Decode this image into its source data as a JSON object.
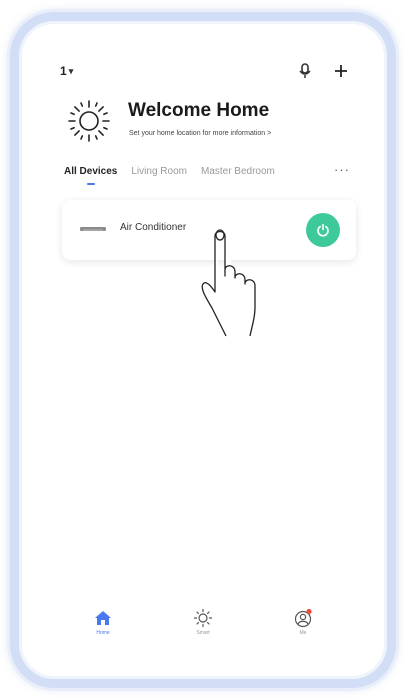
{
  "topbar": {
    "home_label": "1",
    "home_chevron": "chevron-down-icon",
    "icons": [
      "microphone-icon",
      "plus-icon"
    ]
  },
  "welcome": {
    "title": "Welcome Home",
    "subtitle": "Set your home location for more information >",
    "icon": "sun-icon"
  },
  "tabs": [
    {
      "label": "All Devices",
      "active": true
    },
    {
      "label": "Living Room",
      "active": false
    },
    {
      "label": "Master Bedroom",
      "active": false
    }
  ],
  "tabs_more_label": "···",
  "device": {
    "name": "Air Conditioner",
    "icon": "air-conditioner-icon",
    "power_icon": "power-icon",
    "power_color": "#3ec99a"
  },
  "bottom_nav": [
    {
      "label": "Home",
      "icon": "home-icon",
      "active": true
    },
    {
      "label": "Smart",
      "icon": "smart-sun-icon",
      "active": false
    },
    {
      "label": "Me",
      "icon": "profile-icon",
      "active": false
    }
  ],
  "colors": {
    "accent": "#4a78f0",
    "frame": "#d2def5",
    "notification_dot": "#f04a3a"
  }
}
